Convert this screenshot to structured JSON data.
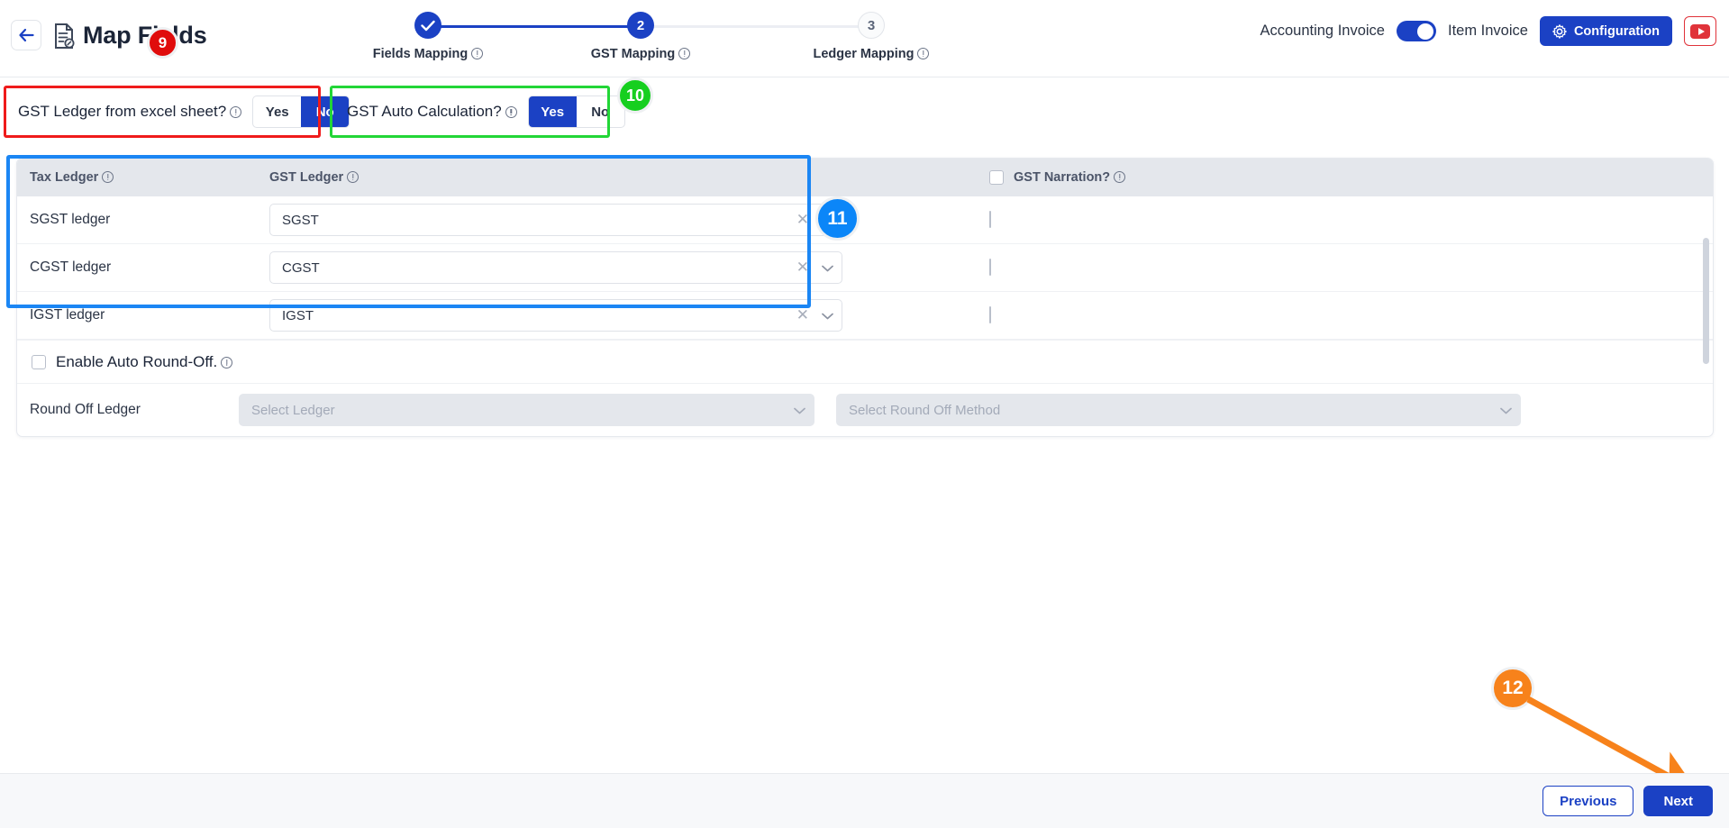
{
  "header": {
    "title": "Map Fields",
    "back_icon": "arrow-left-icon",
    "doc_icon": "document-edit-icon",
    "accounting_invoice_label": "Accounting Invoice",
    "item_invoice_label": "Item Invoice",
    "toggle_state": "on",
    "configuration_label": "Configuration",
    "gear_icon": "gear-icon",
    "youtube_icon": "youtube-icon"
  },
  "stepper": {
    "steps": [
      {
        "num": "1",
        "label": "Fields Mapping",
        "state": "done",
        "mark": "✓"
      },
      {
        "num": "2",
        "label": "GST Mapping",
        "state": "active"
      },
      {
        "num": "3",
        "label": "Ledger Mapping",
        "state": "todo"
      }
    ]
  },
  "options": {
    "excel_ledger": {
      "label": "GST Ledger from excel sheet?",
      "yes": "Yes",
      "no": "No",
      "selected": "No"
    },
    "auto_calc": {
      "label": "GST Auto Calculation?",
      "yes": "Yes",
      "no": "No",
      "selected": "Yes"
    }
  },
  "table": {
    "col_tax_ledger": "Tax Ledger",
    "col_gst_ledger": "GST Ledger",
    "col_gst_narration": "GST Narration?",
    "narration_checked": false,
    "rows": [
      {
        "label": "SGST ledger",
        "value": "SGST"
      },
      {
        "label": "CGST ledger",
        "value": "CGST"
      },
      {
        "label": "IGST ledger",
        "value": "IGST"
      }
    ],
    "clear_icon": "✕",
    "chevron_icon": "⌄"
  },
  "round_off": {
    "enable_label": "Enable Auto Round-Off.",
    "enabled": false,
    "ledger_label": "Round Off Ledger",
    "ledger_placeholder": "Select Ledger",
    "method_placeholder": "Select Round Off Method"
  },
  "footer": {
    "previous_label": "Previous",
    "next_label": "Next"
  },
  "annotations": {
    "badge9": "9",
    "badge10": "10",
    "badge11": "11",
    "badge12": "12"
  },
  "colors": {
    "primary": "#1b41c4",
    "red": "#ef1b1b",
    "green": "#22d637",
    "blue": "#1b86f4",
    "orange": "#f7821b"
  }
}
